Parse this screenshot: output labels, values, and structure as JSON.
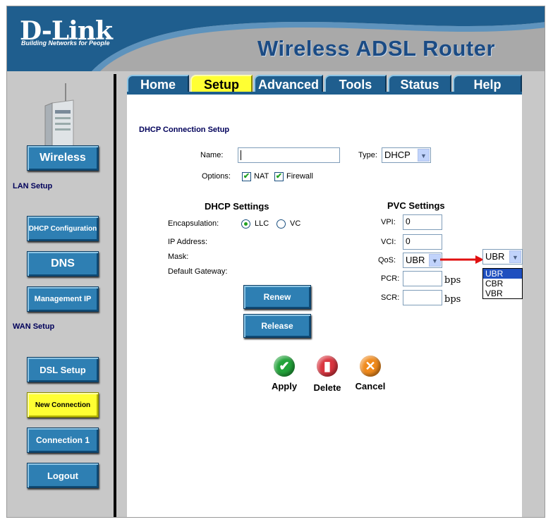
{
  "header": {
    "logo": "D-Link",
    "logo_tagline": "Building Networks for People",
    "title": "Wireless ADSL Router"
  },
  "tabs": [
    {
      "label": "Home"
    },
    {
      "label": "Setup"
    },
    {
      "label": "Advanced"
    },
    {
      "label": "Tools"
    },
    {
      "label": "Status"
    },
    {
      "label": "Help"
    }
  ],
  "sidebar": {
    "wireless": "Wireless",
    "lan_setup": "LAN Setup",
    "dhcp_configuration": "DHCP Configuration",
    "dns": "DNS",
    "management_ip": "Management IP",
    "wan_setup": "WAN Setup",
    "dsl_setup": "DSL Setup",
    "new_connection": "New Connection",
    "connection_1": "Connection 1",
    "logout": "Logout"
  },
  "form": {
    "section_title": "DHCP Connection Setup",
    "name_label": "Name:",
    "name_value": "",
    "type_label": "Type:",
    "type_value": "DHCP",
    "options_label": "Options:",
    "nat_label": "NAT",
    "firewall_label": "Firewall",
    "dhcp_settings_title": "DHCP Settings",
    "encapsulation_label": "Encapsulation:",
    "llc_label": "LLC",
    "vc_label": "VC",
    "ip_address_label": "IP Address:",
    "mask_label": "Mask:",
    "gateway_label": "Default Gateway:",
    "renew_label": "Renew",
    "release_label": "Release",
    "pvc_settings_title": "PVC Settings",
    "vpi_label": "VPI:",
    "vpi_value": "0",
    "vci_label": "VCI:",
    "vci_value": "0",
    "qos_label": "QoS:",
    "qos_value": "UBR",
    "pcr_label": "PCR:",
    "scr_label": "SCR:",
    "bps_unit": "bps",
    "qos_dropdown_value": "UBR",
    "qos_options": [
      "UBR",
      "CBR",
      "VBR"
    ]
  },
  "actions": {
    "apply": "Apply",
    "delete": "Delete",
    "cancel": "Cancel"
  },
  "colors": {
    "accent": "#1f5e8e",
    "active_tab": "#ffff33",
    "title_blue": "#1b4b84"
  }
}
